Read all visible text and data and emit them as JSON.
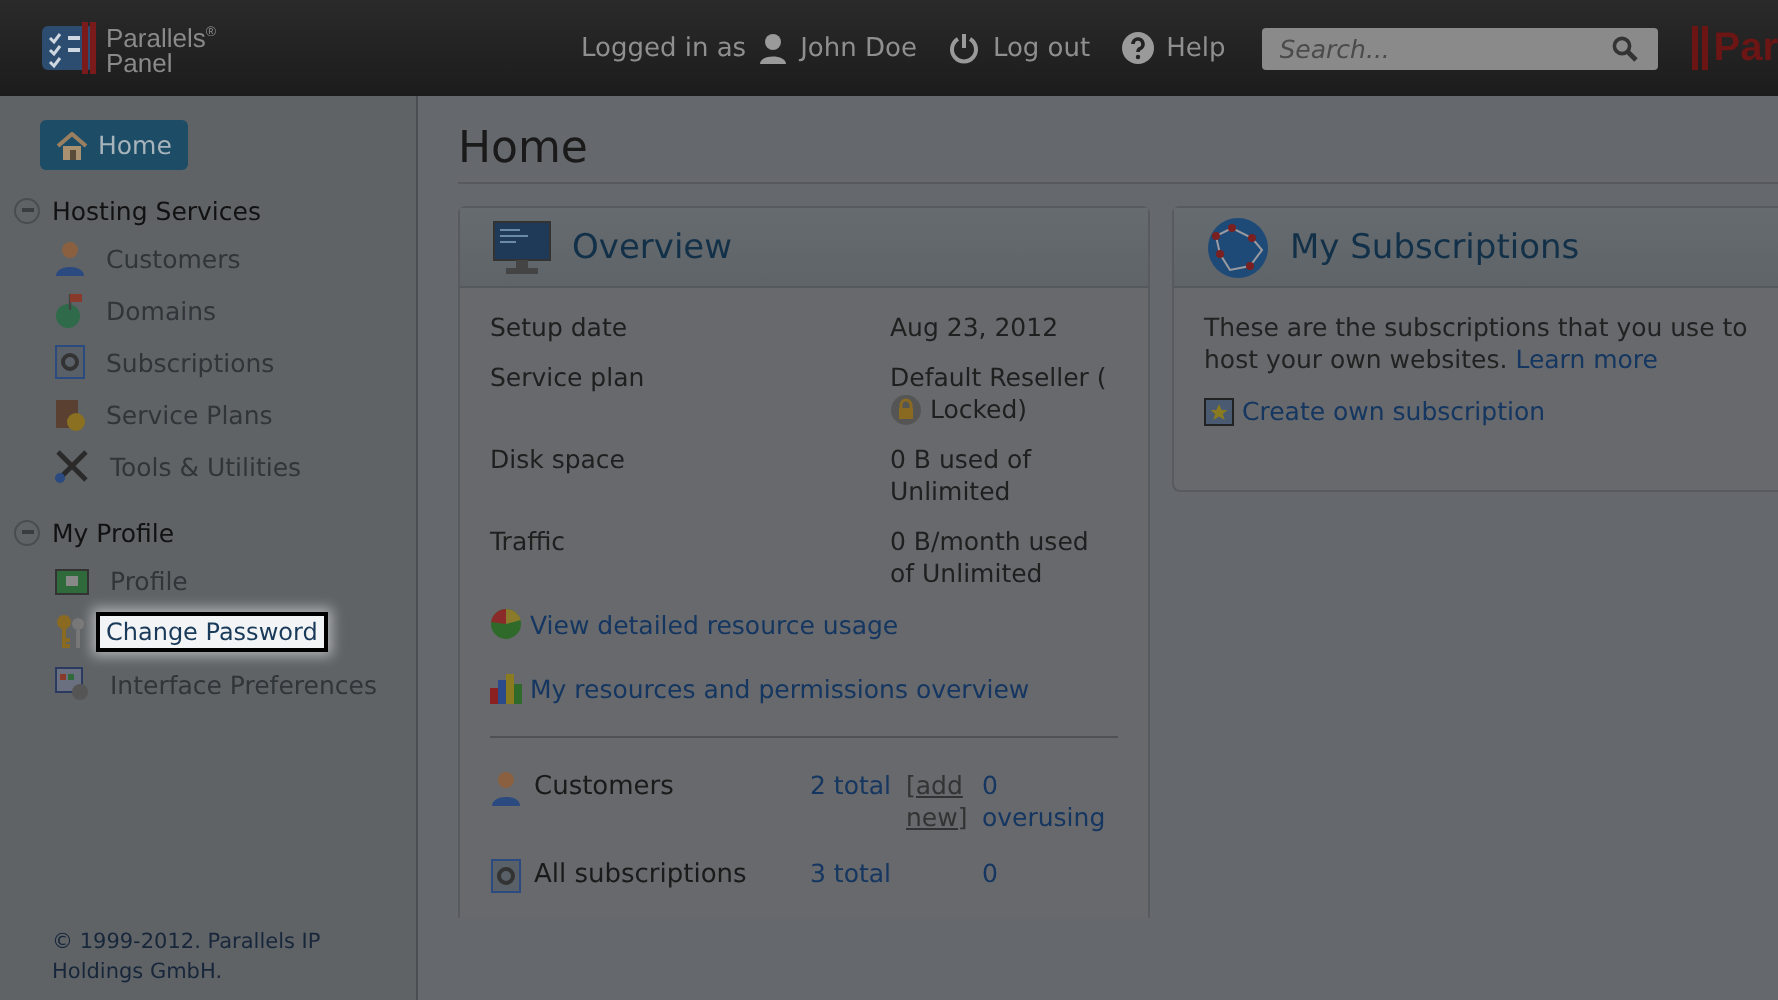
{
  "header": {
    "logo": {
      "line1": "Parallels",
      "sup": "®",
      "line2": "Panel"
    },
    "logged_in_label": "Logged in as",
    "user": "John Doe",
    "logout": "Log out",
    "help": "Help",
    "search": {
      "placeholder": "Search..."
    },
    "brand_cut": "Par"
  },
  "sidebar": {
    "home": {
      "label": "Home",
      "selected": true
    },
    "sections": [
      {
        "title": "Hosting Services",
        "expanded": true,
        "items": [
          {
            "label": "Customers",
            "kind": "person",
            "highlighted": false
          },
          {
            "label": "Domains",
            "kind": "globe",
            "highlighted": false
          },
          {
            "label": "Subscriptions",
            "kind": "gear-doc",
            "highlighted": false
          },
          {
            "label": "Service Plans",
            "kind": "plan",
            "highlighted": false
          },
          {
            "label": "Tools & Utilities",
            "kind": "tools",
            "highlighted": false
          }
        ]
      },
      {
        "title": "My Profile",
        "expanded": true,
        "items": [
          {
            "label": "Profile",
            "kind": "card",
            "highlighted": false
          },
          {
            "label": "Change Password",
            "kind": "keys",
            "highlighted": true
          },
          {
            "label": "Interface Preferences",
            "kind": "prefs",
            "highlighted": false
          }
        ]
      }
    ],
    "copyright": "© 1999-2012. Parallels IP Holdings GmbH."
  },
  "main": {
    "title": "Home",
    "overview": {
      "title": "Overview",
      "rows": [
        {
          "label": "Setup date",
          "value": "Aug 23, 2012",
          "locked": false
        },
        {
          "label": "Service plan",
          "value": "Default Reseller (",
          "value2": "Locked)",
          "locked": true
        },
        {
          "label": "Disk space",
          "value": "0 B used of Unlimited",
          "locked": false
        },
        {
          "label": "Traffic",
          "value": "0 B/month used of Unlimited",
          "locked": false
        }
      ],
      "links": [
        {
          "label": "View detailed resource usage",
          "kind": "pie"
        },
        {
          "label": "My resources and permissions overview",
          "kind": "bars"
        }
      ],
      "stats": [
        {
          "label": "Customers",
          "kind": "person",
          "total": "2 total",
          "add": "[add new]",
          "overusing": "0 overusing"
        },
        {
          "label": "All subscriptions",
          "kind": "gear-doc",
          "total": "3 total",
          "overusing": "0"
        }
      ]
    },
    "subscriptions": {
      "title": "My Subscriptions",
      "text": "These are the subscriptions that you use to host your own websites.",
      "learn_more": "Learn more",
      "create": "Create own subscription"
    }
  }
}
